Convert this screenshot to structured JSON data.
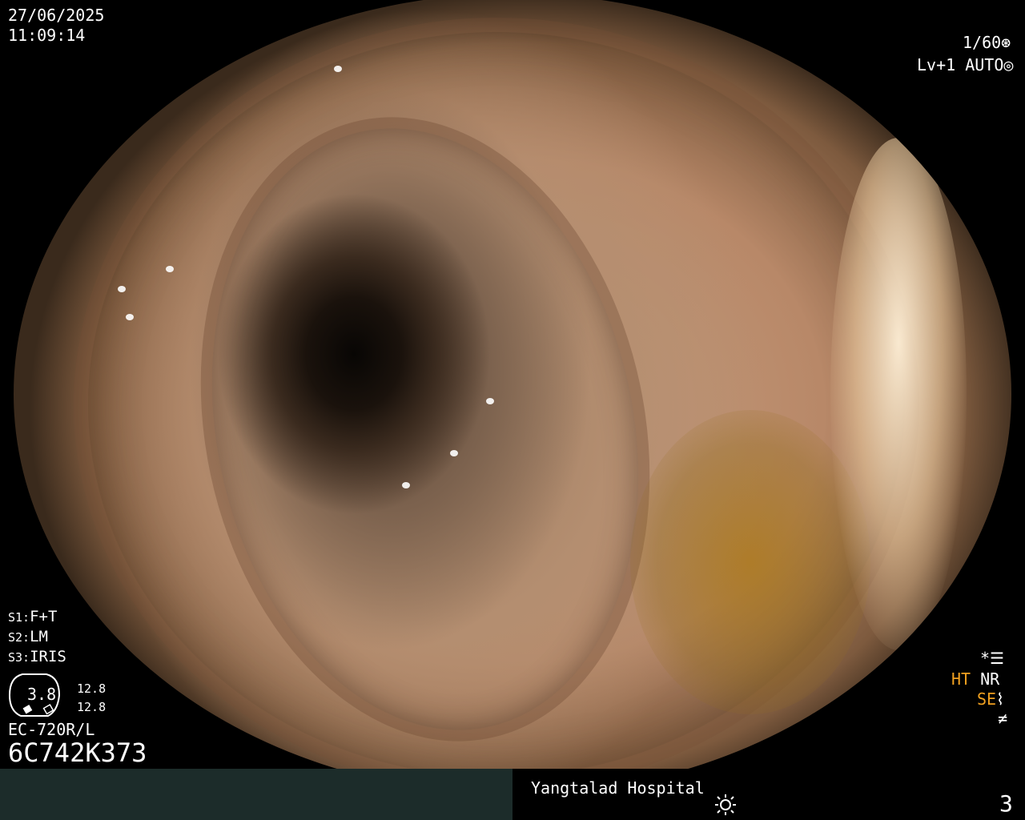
{
  "header": {
    "date": "27/06/2025",
    "time": "11:09:14"
  },
  "top_right": {
    "shutter": "1/60",
    "shutter_icon": "aperture-icon",
    "level": "Lv+1",
    "exposure_mode": "AUTO",
    "exposure_icon": "auto-exposure-icon"
  },
  "settings": {
    "s1_label": "S1:",
    "s1_value": "F+T",
    "s2_label": "S2:",
    "s2_value": "LM",
    "s3_label": "S3:",
    "s3_value": "IRIS"
  },
  "gauge": {
    "value": "3.8",
    "top_reading": "12.8",
    "bottom_reading": "12.8"
  },
  "scope": {
    "model": "EC-720R/L",
    "serial": "6C742K373"
  },
  "right_indicators": {
    "star": "*",
    "settings_icon": "menu-list-icon",
    "ht": "HT",
    "nr": "NR",
    "se": "SE",
    "se_icon": "structure-enhance-icon",
    "last_icon": "not-equal-icon",
    "accent_color": "#f0a020"
  },
  "footer": {
    "hospital": "Yangtalad Hospital",
    "brightness_icon": "sun-icon",
    "image_number": "3"
  }
}
